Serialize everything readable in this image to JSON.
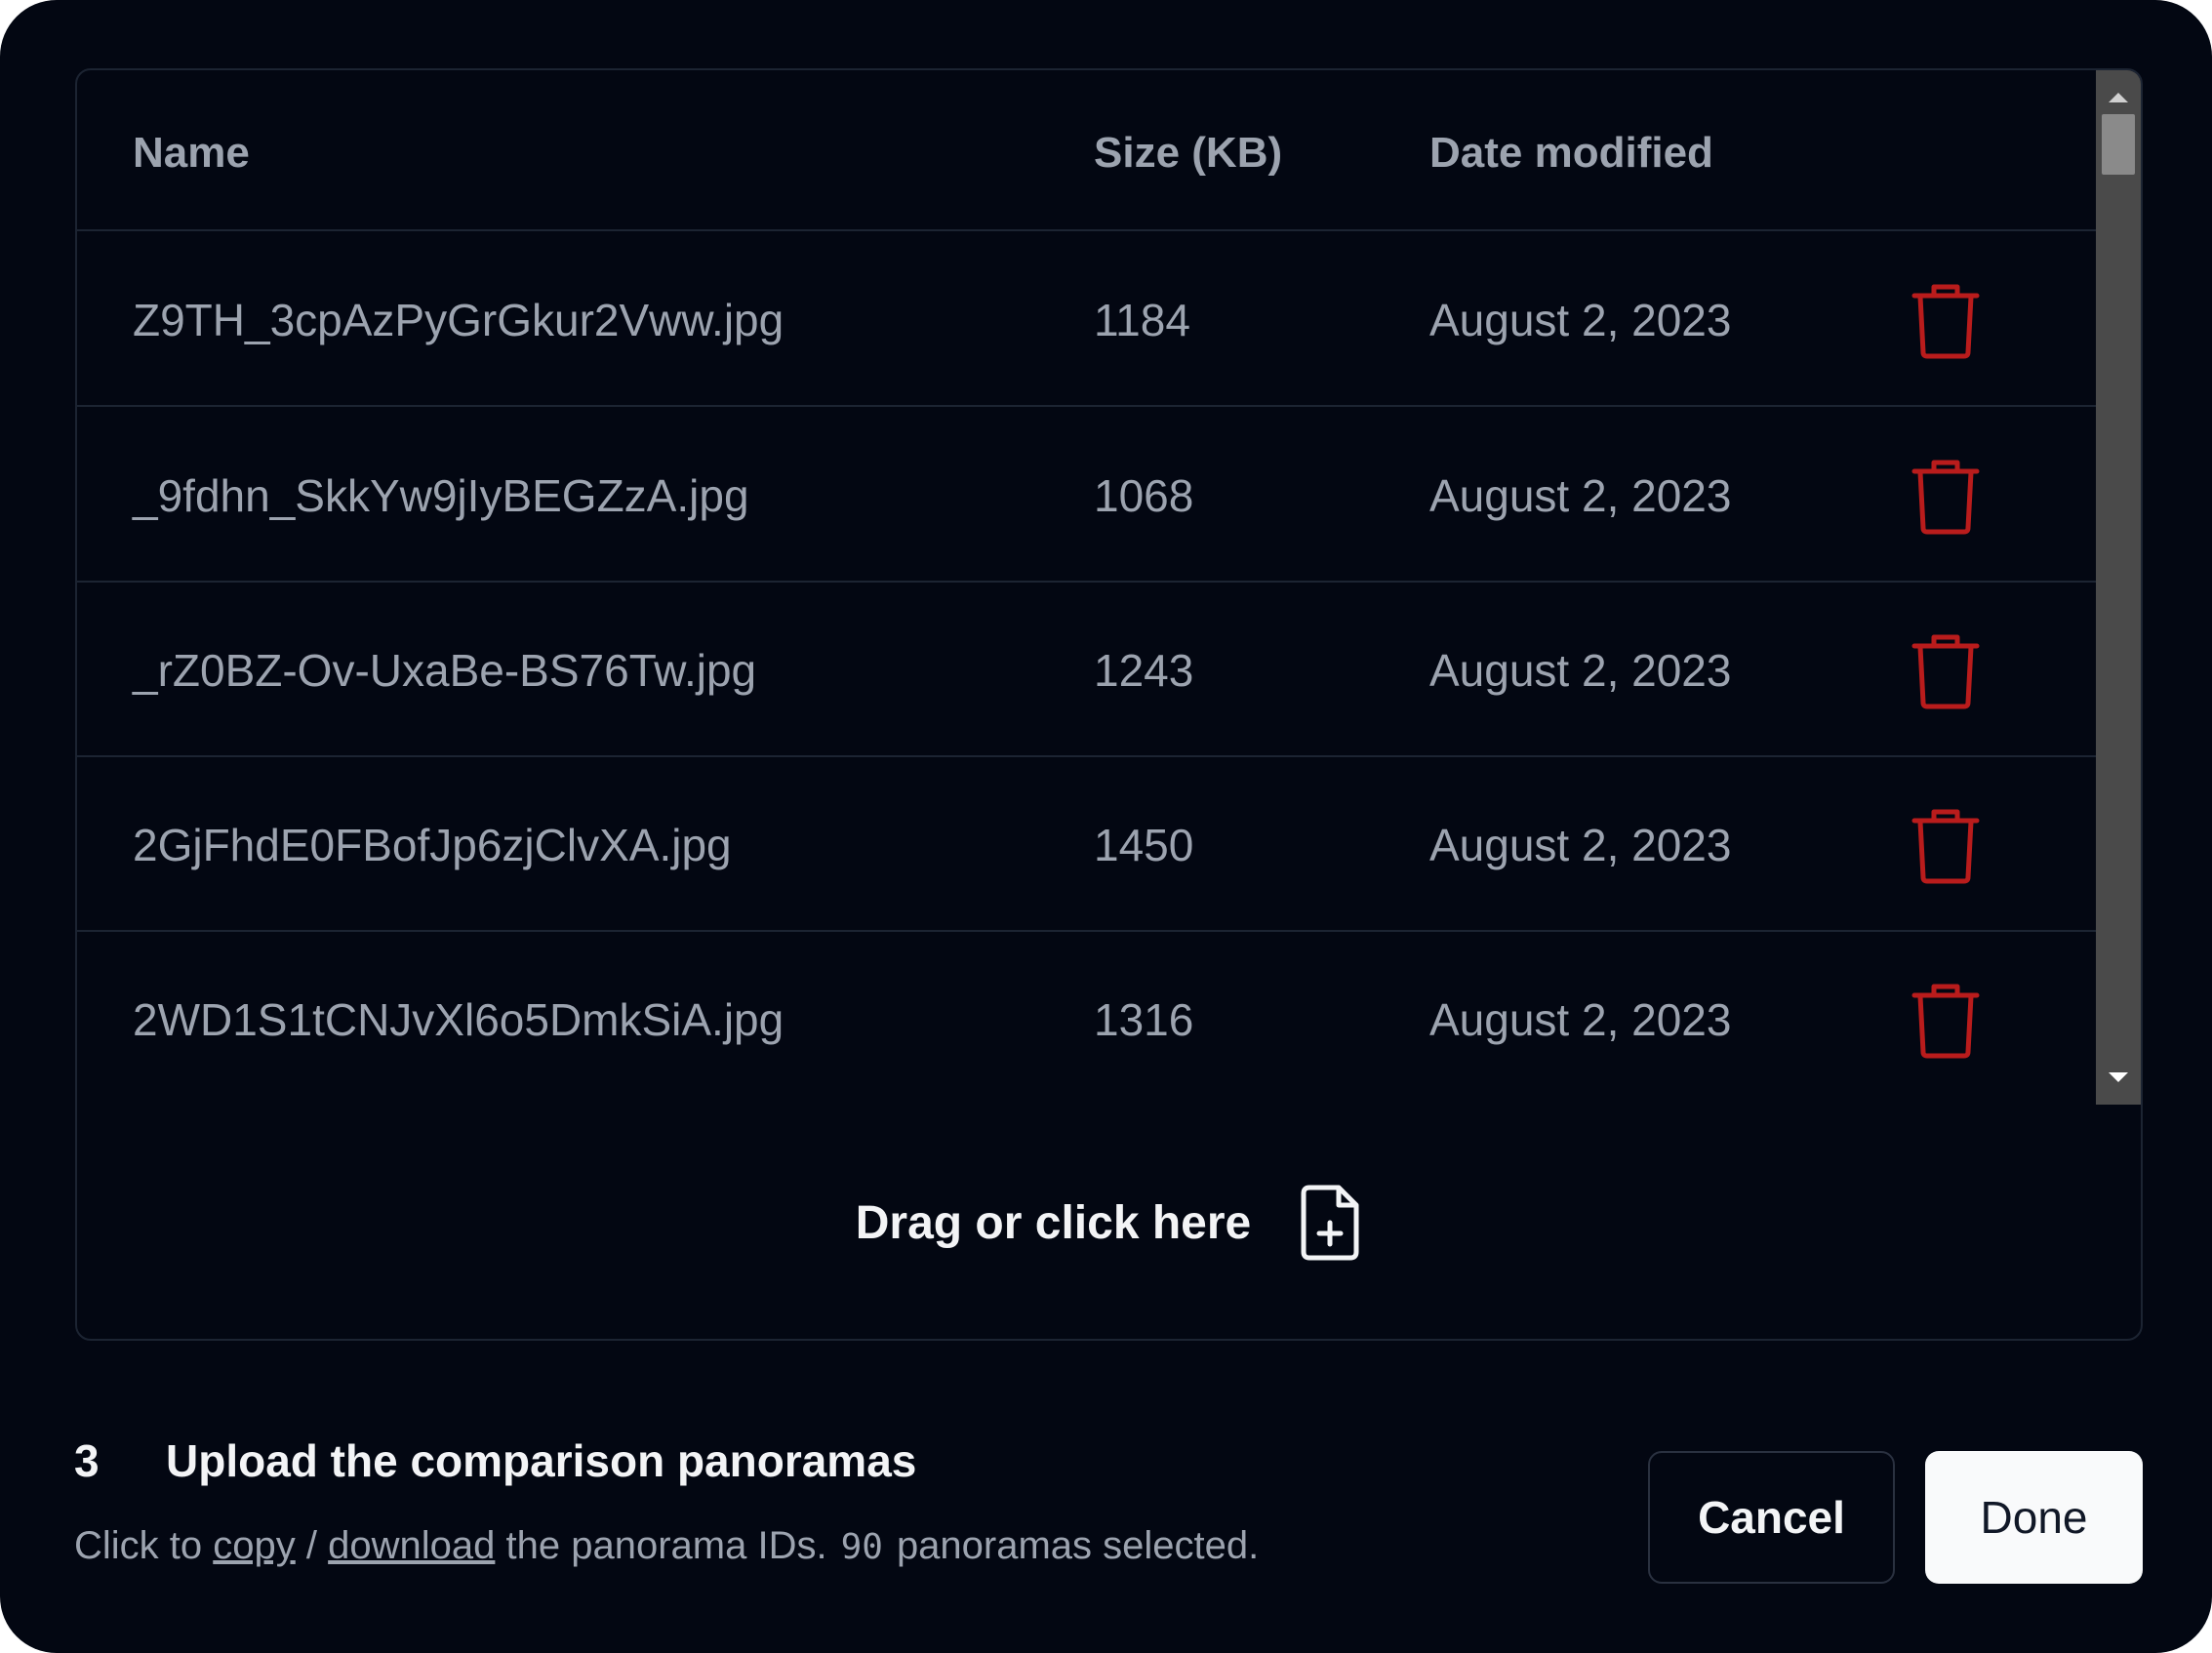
{
  "table": {
    "columns": {
      "name": "Name",
      "size": "Size (KB)",
      "date": "Date modified"
    },
    "rows": [
      {
        "name": "Z9TH_3cpAzPyGrGkur2Vww.jpg",
        "size": "1184",
        "date": "August 2, 2023"
      },
      {
        "name": "_9fdhn_SkkYw9jIyBEGZzA.jpg",
        "size": "1068",
        "date": "August 2, 2023"
      },
      {
        "name": "_rZ0BZ-Ov-UxaBe-BS76Tw.jpg",
        "size": "1243",
        "date": "August 2, 2023"
      },
      {
        "name": "2GjFhdE0FBofJp6zjClvXA.jpg",
        "size": "1450",
        "date": "August 2, 2023"
      },
      {
        "name": "2WD1S1tCNJvXl6o5DmkSiA.jpg",
        "size": "1316",
        "date": "August 2, 2023"
      }
    ],
    "row_action_icon": "trash-icon"
  },
  "dropzone": {
    "label": "Drag or click here",
    "icon": "file-plus-icon"
  },
  "step": {
    "number": "3",
    "title": "Upload the comparison panoramas",
    "desc_prefix": "Click to",
    "copy_link": "copy",
    "separator": "/",
    "download_link": "download",
    "desc_mid": "the panorama IDs.",
    "count": "90",
    "desc_suffix": "panoramas selected."
  },
  "buttons": {
    "cancel": "Cancel",
    "done": "Done"
  },
  "colors": {
    "background": "#030712",
    "text_muted": "#9ca3af",
    "danger": "#b91c1c",
    "primary_button": "#f9fafb"
  }
}
